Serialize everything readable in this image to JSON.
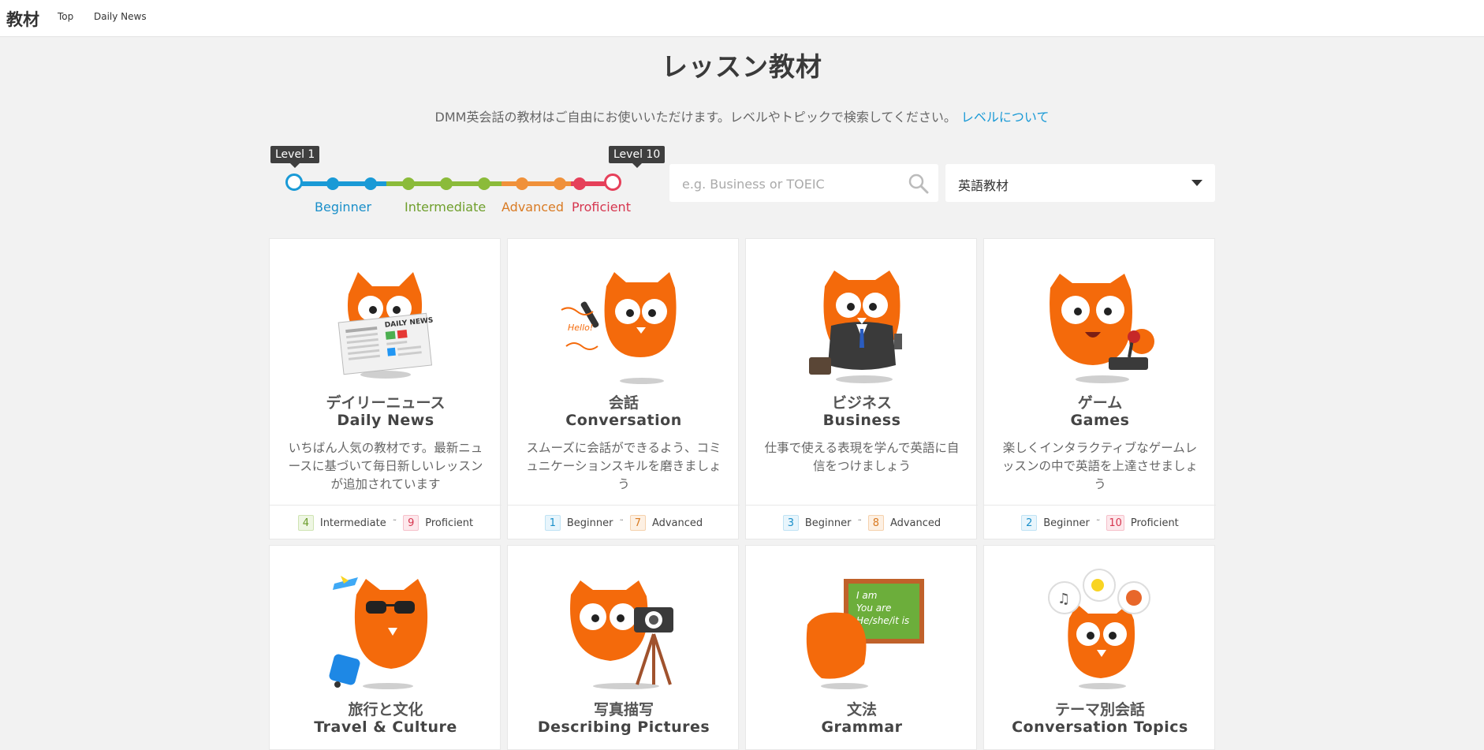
{
  "header": {
    "brand": "教材",
    "nav": [
      "Top",
      "Daily News"
    ]
  },
  "page": {
    "title": "レッスン教材",
    "subtitle": "DMM英会話の教材はご自由にお使いいただけます。レベルやトピックで検索してください。",
    "level_link": "レベルについて"
  },
  "level_slider": {
    "min_tooltip": "Level 1",
    "max_tooltip": "Level 10",
    "selected_min": 1,
    "selected_max": 10,
    "labels": [
      "Beginner",
      "Intermediate",
      "Advanced",
      "Proficient"
    ],
    "colors": {
      "beginner": "#1a9ad6",
      "intermediate": "#8bbb3a",
      "advanced": "#f0913a",
      "proficient": "#e6405a"
    }
  },
  "search": {
    "placeholder": "e.g. Business or TOEIC",
    "value": ""
  },
  "select": {
    "value": "英語教材"
  },
  "cards": [
    {
      "jp": "デイリーニュース",
      "en": "Daily News",
      "desc": "いちばん人気の教材です。最新ニュースに基づいて毎日新しいレッスンが追加されています",
      "from_num": "4",
      "from_label": "Intermediate",
      "to_num": "9",
      "to_label": "Proficient",
      "illustration": "owl-newspaper",
      "newspaper_text": "DAILY NEWS"
    },
    {
      "jp": "会話",
      "en": "Conversation",
      "desc": "スムーズに会話ができるよう、コミュニケーションスキルを磨きましょう",
      "from_num": "1",
      "from_label": "Beginner",
      "to_num": "7",
      "to_label": "Advanced",
      "illustration": "owl-phone",
      "phone_text": "Hello!"
    },
    {
      "jp": "ビジネス",
      "en": "Business",
      "desc": "仕事で使える表現を学んで英語に自信をつけましょう",
      "from_num": "3",
      "from_label": "Beginner",
      "to_num": "8",
      "to_label": "Advanced",
      "illustration": "owl-suit"
    },
    {
      "jp": "ゲーム",
      "en": "Games",
      "desc": "楽しくインタラクティブなゲームレッスンの中で英語を上達させましょう",
      "from_num": "2",
      "from_label": "Beginner",
      "to_num": "10",
      "to_label": "Proficient",
      "illustration": "owl-joystick"
    },
    {
      "jp": "旅行と文化",
      "en": "Travel & Culture",
      "illustration": "owl-sunglasses-suitcase"
    },
    {
      "jp": "写真描写",
      "en": "Describing Pictures",
      "illustration": "owl-camera"
    },
    {
      "jp": "文法",
      "en": "Grammar",
      "illustration": "owl-blackboard",
      "board_lines": [
        "I am",
        "You are",
        "He/she/it is"
      ]
    },
    {
      "jp": "テーマ別会話",
      "en": "Conversation Topics",
      "illustration": "owl-thought-bubbles"
    }
  ]
}
